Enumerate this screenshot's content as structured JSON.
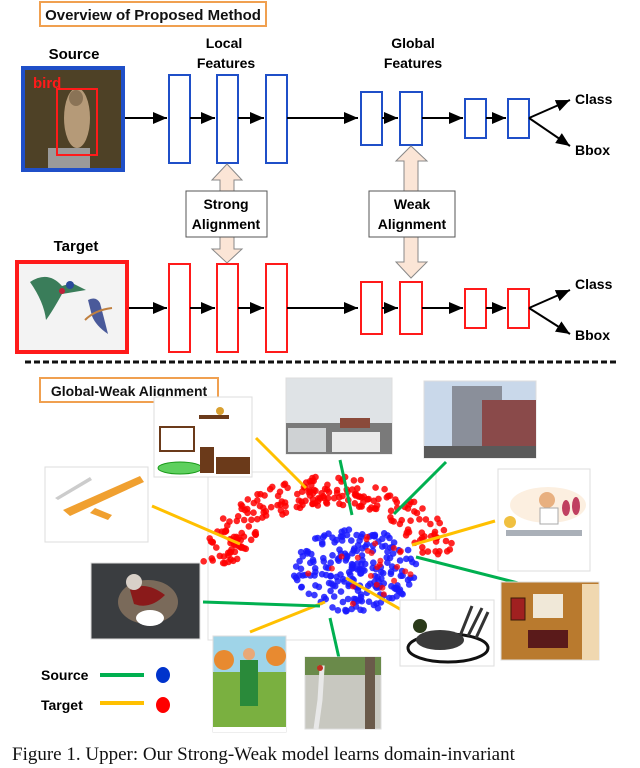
{
  "upper": {
    "title": "Overview of Proposed Method",
    "source_label": "Source",
    "target_label": "Target",
    "bird_tag": "bird",
    "local_features": [
      "Local",
      "Features"
    ],
    "global_features": [
      "Global",
      "Features"
    ],
    "strong_alignment": [
      "Strong",
      "Alignment"
    ],
    "weak_alignment": [
      "Weak",
      "Alignment"
    ],
    "outputs": [
      "Class",
      "Bbox"
    ]
  },
  "lower": {
    "title": "Global-Weak Alignment",
    "legend": [
      {
        "label": "Source",
        "line_color": "#00b050",
        "dot_color": "#0033cc"
      },
      {
        "label": "Target",
        "line_color": "#ffc000",
        "dot_color": "#ff0000"
      }
    ],
    "thumbnails": [
      {
        "name": "nursery-clipart",
        "domain": "target"
      },
      {
        "name": "glider-clipart",
        "domain": "target"
      },
      {
        "name": "street-traffic-photo",
        "domain": "source"
      },
      {
        "name": "city-building-photo",
        "domain": "source"
      },
      {
        "name": "butcher-clipart",
        "domain": "target"
      },
      {
        "name": "dining-room-photo",
        "domain": "source"
      },
      {
        "name": "duck-clipart",
        "domain": "target"
      },
      {
        "name": "crane-bird-photo",
        "domain": "source"
      },
      {
        "name": "gardener-clipart",
        "domain": "target"
      },
      {
        "name": "cat-photo",
        "domain": "source"
      }
    ]
  },
  "colors": {
    "source": "#1f4fc8",
    "target": "#ff1a1a",
    "arrow_fill": "#fbe5d6",
    "title_border": "#f0a050",
    "green_line": "#00b050",
    "yellow_line": "#ffc000",
    "red_dot": "#ff0000",
    "blue_dot": "#1a1aff"
  },
  "caption": "Figure 1. Upper: Our Strong-Weak model learns domain-invariant"
}
